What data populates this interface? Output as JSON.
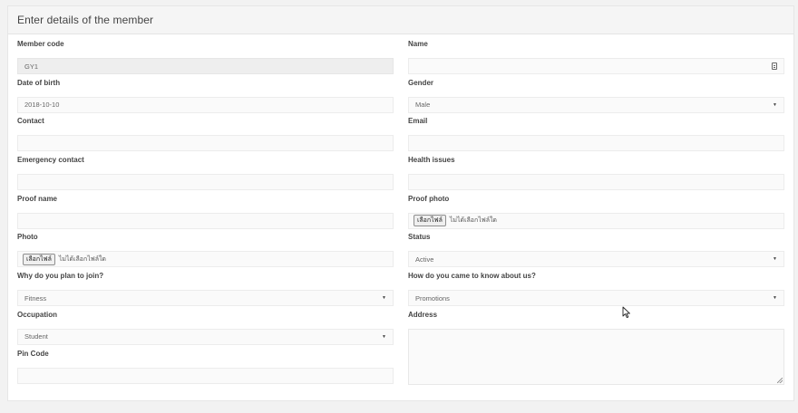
{
  "panel": {
    "title": "Enter details of the member"
  },
  "left": {
    "member_code": {
      "label": "Member code",
      "value": "GY1"
    },
    "dob": {
      "label": "Date of birth",
      "value": "2018-10-10"
    },
    "contact": {
      "label": "Contact",
      "value": ""
    },
    "emergency": {
      "label": "Emergency contact",
      "value": ""
    },
    "proof_name": {
      "label": "Proof name",
      "value": ""
    },
    "photo": {
      "label": "Photo",
      "button": "เลือกไฟล์",
      "status": "ไม่ได้เลือกไฟล์ใด"
    },
    "why_join": {
      "label": "Why do you plan to join?",
      "value": "Fitness"
    },
    "occupation": {
      "label": "Occupation",
      "value": "Student"
    },
    "pin_code": {
      "label": "Pin Code",
      "value": ""
    }
  },
  "right": {
    "name": {
      "label": "Name",
      "value": "",
      "icon": "contact-card-icon"
    },
    "gender": {
      "label": "Gender",
      "value": "Male"
    },
    "email": {
      "label": "Email",
      "value": ""
    },
    "health": {
      "label": "Health issues",
      "value": ""
    },
    "proof_photo": {
      "label": "Proof photo",
      "button": "เลือกไฟล์",
      "status": "ไม่ได้เลือกไฟล์ใด"
    },
    "status": {
      "label": "Status",
      "value": "Active"
    },
    "know_about": {
      "label": "How do you came to know about us?",
      "value": "Promotions"
    },
    "address": {
      "label": "Address",
      "value": ""
    }
  },
  "colors": {
    "page_bg": "#f2f2f2",
    "panel_bg": "#ffffff",
    "header_bg": "#f5f5f5",
    "input_bg": "#fafafa",
    "readonly_bg": "#eeeeee"
  }
}
